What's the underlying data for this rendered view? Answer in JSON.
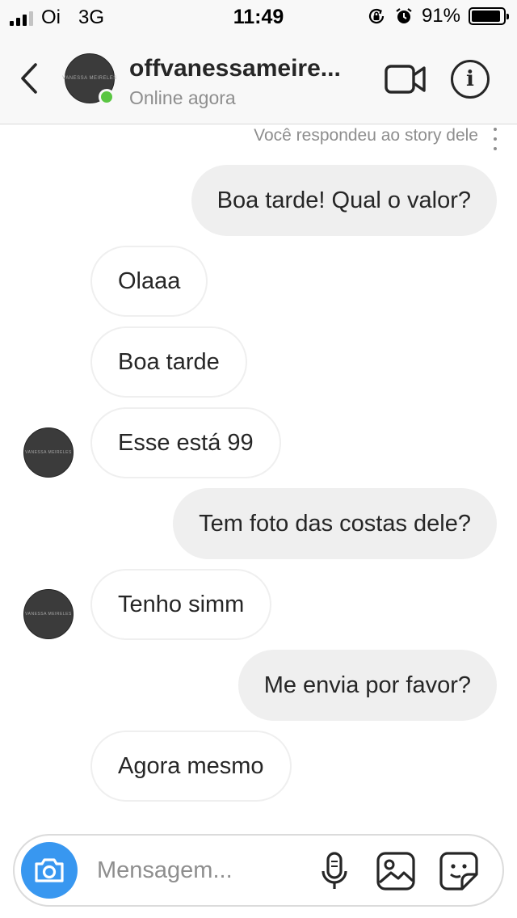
{
  "status_bar": {
    "carrier": "Oi",
    "network": "3G",
    "time": "11:49",
    "battery": "91%",
    "battery_level": 0.91,
    "icons": [
      "signal-icon",
      "rotation-lock-icon",
      "alarm-icon",
      "battery-icon"
    ]
  },
  "header": {
    "username": "offvanessameire...",
    "status": "Online agora",
    "avatar_text": "VANESSA MEIRELES",
    "online_color": "#5ac642"
  },
  "thread": {
    "story_note": "Você respondeu ao story dele",
    "messages": [
      {
        "direction": "out",
        "text": "Boa tarde! Qual o valor?"
      },
      {
        "direction": "in",
        "text": "Olaaa"
      },
      {
        "direction": "in",
        "text": "Boa tarde"
      },
      {
        "direction": "in",
        "text": "Esse está 99",
        "avatar": true
      },
      {
        "direction": "out",
        "text": "Tem foto das costas dele?"
      },
      {
        "direction": "in",
        "text": "Tenho simm",
        "avatar": true
      },
      {
        "direction": "out",
        "text": "Me envia por favor?"
      },
      {
        "direction": "in",
        "text": "Agora mesmo"
      }
    ]
  },
  "composer": {
    "placeholder": "Mensagem...",
    "icons": [
      "camera-icon",
      "microphone-icon",
      "gallery-icon",
      "sticker-icon"
    ],
    "accent": "#3897f0"
  }
}
